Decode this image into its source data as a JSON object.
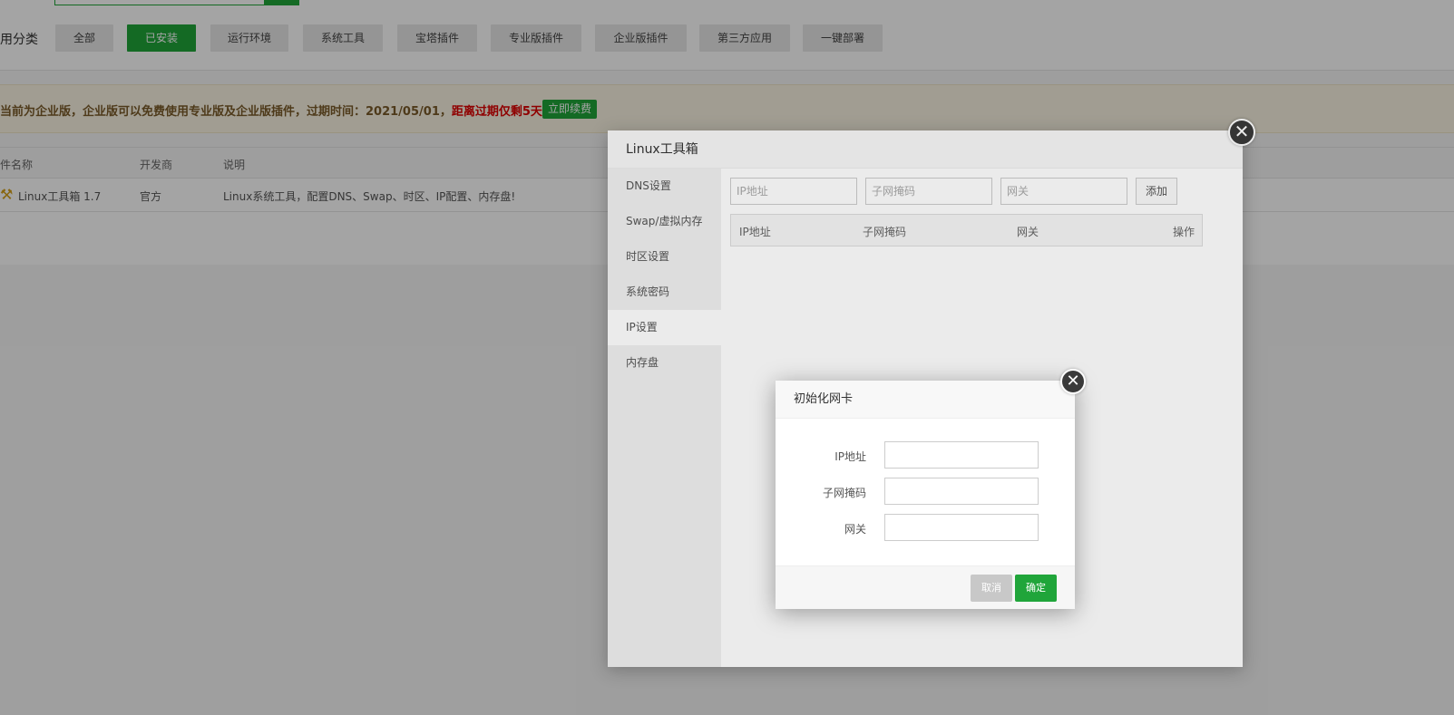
{
  "categories": {
    "label": "用分类",
    "items": [
      "全部",
      "已安装",
      "运行环境",
      "系统工具",
      "宝塔插件",
      "专业版插件",
      "企业版插件",
      "第三方应用",
      "一键部署"
    ],
    "active_index": 1
  },
  "notice": {
    "text": "当前为企业版，企业版可以免费使用专业版及企业版插件，过期时间：2021/05/01，",
    "warn": "距离过期仅剩5天",
    "renew_label": "立即续费"
  },
  "plugin_table": {
    "headers": [
      "件名称",
      "开发商",
      "说明"
    ],
    "row": {
      "icon": "tools-icon",
      "name": "Linux工具箱 1.7",
      "developer": "官方",
      "description": "Linux系统工具，配置DNS、Swap、时区、IP配置、内存盘!"
    }
  },
  "toolbox": {
    "title": "Linux工具箱",
    "menu": [
      "DNS设置",
      "Swap/虚拟内存",
      "时区设置",
      "系统密码",
      "IP设置",
      "内存盘"
    ],
    "active_index": 4,
    "ip_placeholder": "IP地址",
    "mask_placeholder": "子网掩码",
    "gateway_placeholder": "网关",
    "add_label": "添加",
    "table_headers": [
      "IP地址",
      "子网掩码",
      "网关",
      "操作"
    ]
  },
  "init_dialog": {
    "title": "初始化网卡",
    "ip_label": "IP地址",
    "mask_label": "子网掩码",
    "gateway_label": "网关",
    "ip_value": "",
    "mask_value": "",
    "gateway_value": "",
    "cancel_label": "取消",
    "ok_label": "确定"
  },
  "colors": {
    "accent": "#20a53a",
    "warn": "#e00000"
  }
}
